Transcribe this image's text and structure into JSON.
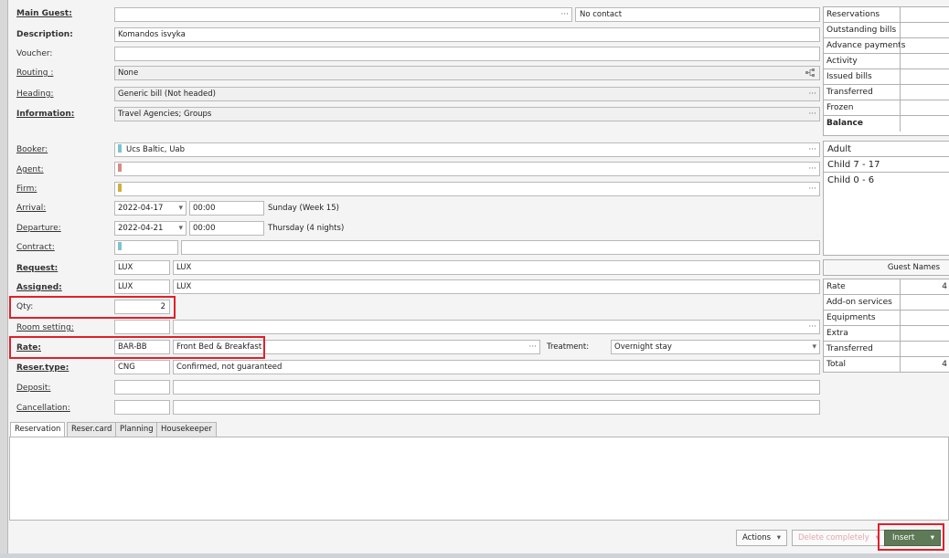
{
  "labels": {
    "main_guest": "Main Guest:",
    "description": "Description:",
    "voucher": "Voucher:",
    "routing": "Routing :",
    "heading": "Heading:",
    "information": "Information:",
    "booker": "Booker:",
    "agent": "Agent:",
    "firm": "Firm:",
    "arrival": "Arrival:",
    "departure": "Departure:",
    "contract": "Contract:",
    "request": "Request:",
    "assigned": "Assigned:",
    "qty": "Qty:",
    "room_setting": "Room setting:",
    "rate": "Rate:",
    "reser_type": "Reser.type:",
    "deposit": "Deposit:",
    "cancellation": "Cancellation:",
    "treatment": "Treatment:"
  },
  "values": {
    "main_guest_contact": "No contact",
    "description": "Komandos isvyka",
    "voucher": "",
    "routing": "None",
    "heading": "Generic bill (Not headed)",
    "information": "Travel Agencies; Groups",
    "booker": "Ucs Baltic, Uab",
    "arrival_date": "2022-04-17",
    "arrival_time": "00:00",
    "arrival_day": "Sunday (Week 15)",
    "departure_date": "2022-04-21",
    "departure_time": "00:00",
    "departure_day": "Thursday (4 nights)",
    "request_code": "LUX",
    "request_name": "LUX",
    "assigned_code": "LUX",
    "assigned_name": "LUX",
    "qty": "2",
    "rate_code": "BAR-BB",
    "rate_name": "Front Bed & Breakfast",
    "treatment": "Overnight stay",
    "reser_type_code": "CNG",
    "reser_type_name": "Confirmed, not guaranteed"
  },
  "dots": "···",
  "dropdown_arrow": "▾",
  "swatches": {
    "booker": "#7fc3cf",
    "agent": "#d88a8a",
    "firm": "#cdb040",
    "contract": "#7fc3cf"
  },
  "summary": [
    "Reservations",
    "Outstanding bills",
    "Advance payments",
    "Activity",
    "Issued bills",
    "Transferred",
    "Frozen",
    "Balance"
  ],
  "guests": [
    "Adult",
    "Child 7 - 17",
    "Child 0 - 6"
  ],
  "guest_names_header": "Guest Names",
  "totals": [
    {
      "label": "Rate",
      "value": "4"
    },
    {
      "label": "Add-on services",
      "value": ""
    },
    {
      "label": "Equipments",
      "value": ""
    },
    {
      "label": "Extra",
      "value": ""
    },
    {
      "label": "Transferred",
      "value": ""
    },
    {
      "label": "Total",
      "value": "4"
    }
  ],
  "tabs": [
    "Reservation",
    "Reser.card",
    "Planning",
    "Housekeeper"
  ],
  "buttons": {
    "actions": "Actions",
    "delete": "Delete completely",
    "insert": "Insert"
  },
  "colors": {
    "highlight": "#e0202a",
    "insert_button": "#5f7a57"
  }
}
